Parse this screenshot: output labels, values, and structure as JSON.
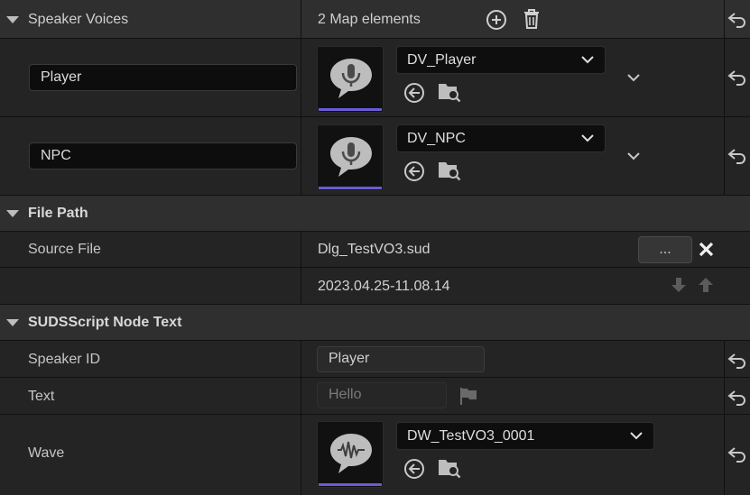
{
  "speaker_voices": {
    "title": "Speaker Voices",
    "count_label": "2 Map elements",
    "entries": [
      {
        "key": "Player",
        "asset": "DV_Player"
      },
      {
        "key": "NPC",
        "asset": "DV_NPC"
      }
    ]
  },
  "file_path": {
    "title": "File Path",
    "source_label": "Source File",
    "source_value": "Dlg_TestVO3.sud",
    "browse_label": "...",
    "timestamp": "2023.04.25-11.08.14"
  },
  "node_text": {
    "title": "SUDSScript Node Text",
    "speaker_label": "Speaker ID",
    "speaker_value": "Player",
    "text_label": "Text",
    "text_value": "Hello",
    "wave_label": "Wave",
    "wave_asset": "DW_TestVO3_0001"
  },
  "colors": {
    "accent_bar": "#6a5cd6",
    "panel": "#242424",
    "category": "#2f2f2f"
  }
}
